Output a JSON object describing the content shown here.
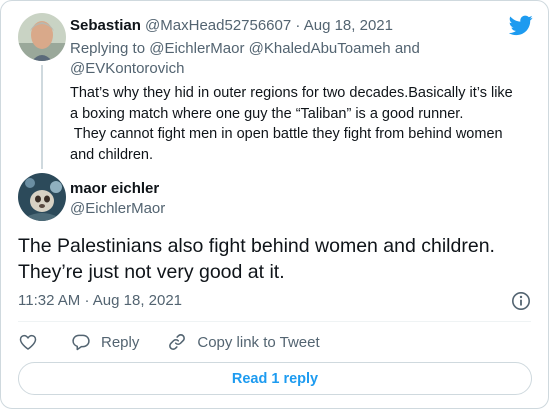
{
  "brand": {
    "accent": "#1d9bf0",
    "icon": "twitter-bird-icon"
  },
  "parent_tweet": {
    "author_name": "Sebastian",
    "author_handle": "@MaxHead52756607",
    "separator": "·",
    "date": "Aug 18, 2021",
    "replying_to_prefix": "Replying to",
    "replying_to_handles": [
      "@EichlerMaor",
      "@KhaledAbuToameh",
      "@EVKontorovich"
    ],
    "replying_to_conjunction": "and",
    "text_lines": [
      "That’s why they hid in outer regions for two decades.Basically it’s like",
      "a boxing match where one guy the “Taliban” is a good runner.",
      " They cannot fight men in open battle they fight from behind women",
      "and children."
    ]
  },
  "main_tweet": {
    "author_name": "maor eichler",
    "author_handle": "@EichlerMaor",
    "text_lines": [
      "The Palestinians also fight behind women and children.",
      "They’re just not very good at it."
    ],
    "time": "11:32 AM",
    "separator": "·",
    "date": "Aug 18, 2021"
  },
  "actions": {
    "like_icon": "heart-icon",
    "reply_label": "Reply",
    "reply_icon": "comment-icon",
    "copy_label": "Copy link to Tweet",
    "copy_icon": "link-icon",
    "info_icon": "info-icon"
  },
  "read_replies_label": "Read 1 reply"
}
